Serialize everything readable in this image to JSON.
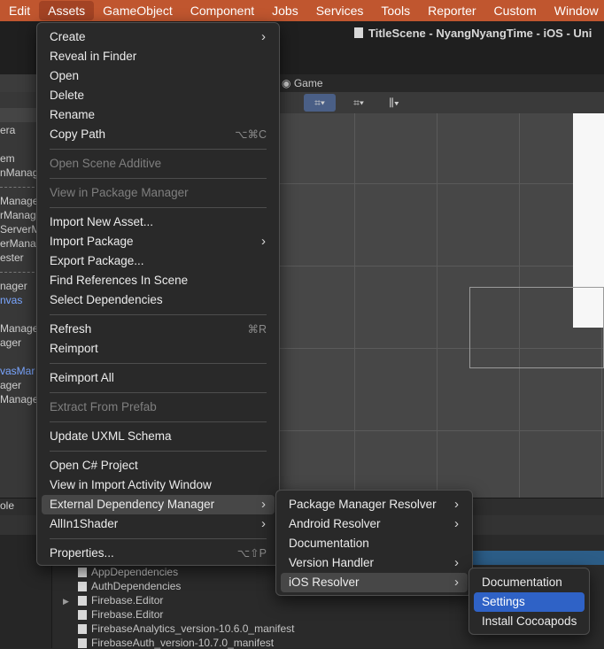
{
  "menubar": {
    "items": [
      "Edit",
      "Assets",
      "GameObject",
      "Component",
      "Jobs",
      "Services",
      "Tools",
      "Reporter",
      "Custom",
      "Window"
    ],
    "active": "Assets"
  },
  "window": {
    "title": "TitleScene - NyangNyangTime - iOS - Uni"
  },
  "hierarchy": {
    "rows": [
      "era",
      "em",
      "nManag",
      "Manage",
      "rManag",
      "ServerM",
      "erMana",
      "ester",
      "nager",
      "nvas",
      "Manage",
      "ager",
      "vasMar",
      "ager",
      "Manage"
    ]
  },
  "scene": {
    "game_tab": "Game"
  },
  "bottom": {
    "left_label": "ole"
  },
  "project_files": [
    "AppDependencies",
    "AuthDependencies",
    "Firebase.Editor",
    "Firebase.Editor",
    "FirebaseAnalytics_version-10.6.0_manifest",
    "FirebaseAuth_version-10.7.0_manifest"
  ],
  "assets_menu": {
    "create": "Create",
    "reveal": "Reveal in Finder",
    "open": "Open",
    "delete": "Delete",
    "rename": "Rename",
    "copy_path": "Copy Path",
    "copy_path_shortcut": "⌥⌘C",
    "open_scene_additive": "Open Scene Additive",
    "view_in_package_manager": "View in Package Manager",
    "import_new_asset": "Import New Asset...",
    "import_package": "Import Package",
    "export_package": "Export Package...",
    "find_references": "Find References In Scene",
    "select_dependencies": "Select Dependencies",
    "refresh": "Refresh",
    "refresh_shortcut": "⌘R",
    "reimport": "Reimport",
    "reimport_all": "Reimport All",
    "extract_from_prefab": "Extract From Prefab",
    "update_uxml": "Update UXML Schema",
    "open_csharp": "Open C# Project",
    "view_import_activity": "View in Import Activity Window",
    "external_dependency_manager": "External Dependency Manager",
    "allin1shader": "AllIn1Shader",
    "properties": "Properties...",
    "properties_shortcut": "⌥⇧P"
  },
  "edm_menu": {
    "package_manager_resolver": "Package Manager Resolver",
    "android_resolver": "Android Resolver",
    "documentation": "Documentation",
    "version_handler": "Version Handler",
    "ios_resolver": "iOS Resolver"
  },
  "ios_menu": {
    "documentation": "Documentation",
    "settings": "Settings",
    "install_cocoapods": "Install Cocoapods"
  },
  "colors": {
    "menubar": "#c0562f",
    "selection": "#2f62c6",
    "menu_bg": "#292929"
  }
}
